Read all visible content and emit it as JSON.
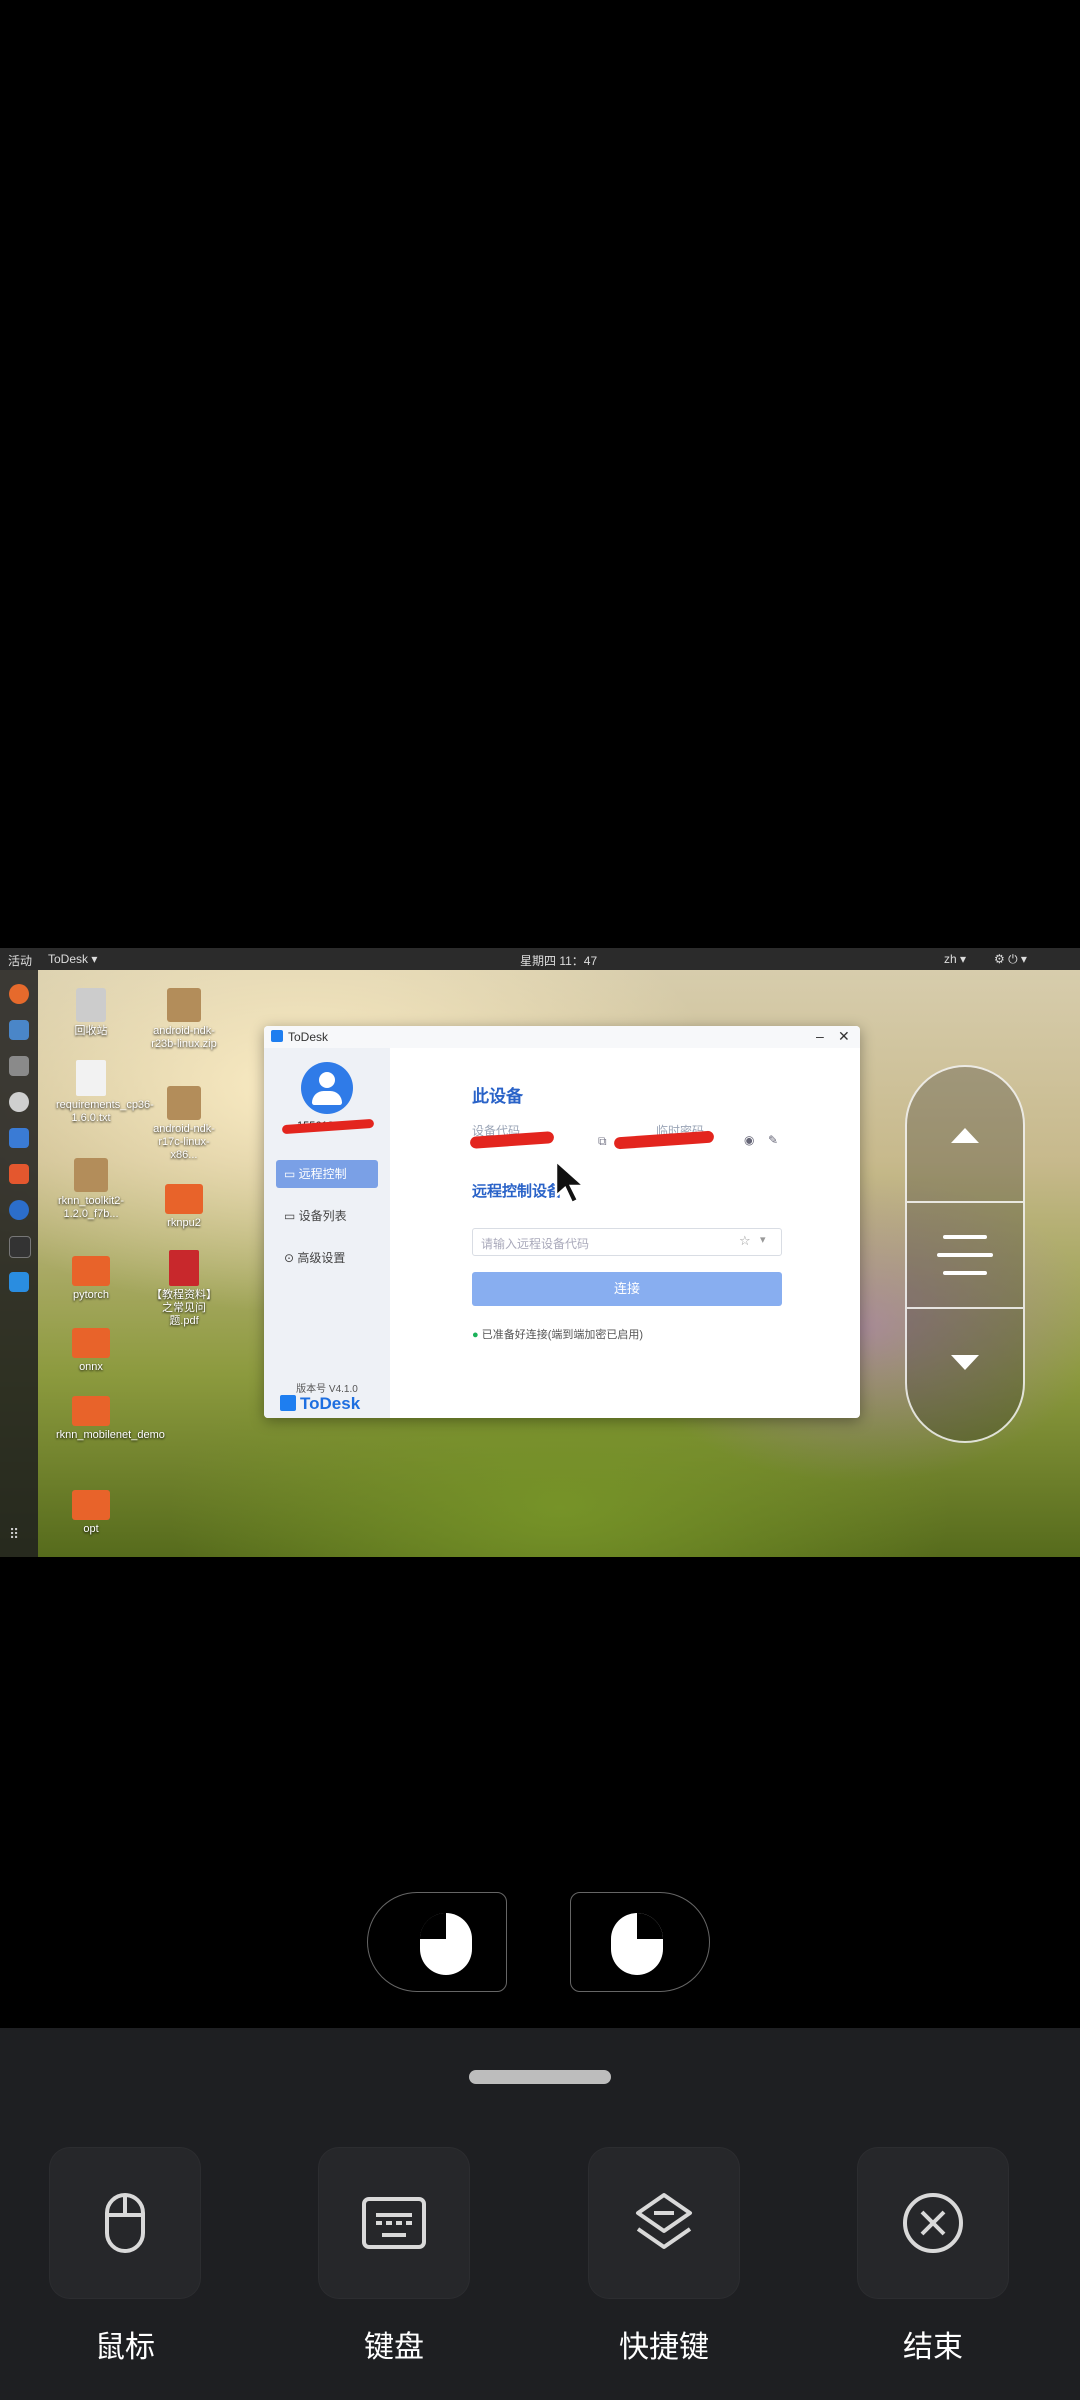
{
  "desktop": {
    "topbar": {
      "activities": "活动",
      "app_menu": "ToDesk ▾",
      "clock": "星期四 11：47",
      "lang": "zh ▾"
    },
    "icons": [
      {
        "name": "recycle-bin",
        "label": "回收站"
      },
      {
        "name": "android-ndk-r23b",
        "label": "android-ndk-r23b-linux.zip"
      },
      {
        "name": "requirements",
        "label": "requirements_cp36-1.6.0.txt"
      },
      {
        "name": "android-ndk-r17c",
        "label": "android-ndk-r17c-linux-x86..."
      },
      {
        "name": "rknn-toolkit2",
        "label": "rknn_toolkit2-1.2.0_f7b..."
      },
      {
        "name": "rknpu2",
        "label": "rknpu2"
      },
      {
        "name": "pytorch",
        "label": "pytorch"
      },
      {
        "name": "pdf-doc",
        "label": "【教程资料】之常见问题.pdf"
      },
      {
        "name": "onnx",
        "label": "onnx"
      },
      {
        "name": "rknn-mobilenet-demo",
        "label": "rknn_mobilenet_demo"
      },
      {
        "name": "opt",
        "label": "opt"
      }
    ]
  },
  "todesk": {
    "title": "ToDesk",
    "account": "1556183****",
    "nav": [
      {
        "label": "远程控制",
        "active": true
      },
      {
        "label": "设备列表",
        "active": false
      },
      {
        "label": "高级设置",
        "active": false
      }
    ],
    "version": "版本号 V4.1.0",
    "brand": "ToDesk",
    "this_device": {
      "title": "此设备",
      "device_code_label": "设备代码",
      "temp_password_label": "临时密码"
    },
    "remote": {
      "title": "远程控制设备",
      "placeholder": "请输入远程设备代码",
      "connect_label": "连接",
      "status": "已准备好连接(端到端加密已启用)"
    }
  },
  "toolbar": {
    "items": [
      {
        "label": "鼠标",
        "icon": "mouse-icon"
      },
      {
        "label": "键盘",
        "icon": "keyboard-icon"
      },
      {
        "label": "快捷键",
        "icon": "shortcut-icon"
      },
      {
        "label": "结束",
        "icon": "close-circle-icon"
      }
    ]
  }
}
